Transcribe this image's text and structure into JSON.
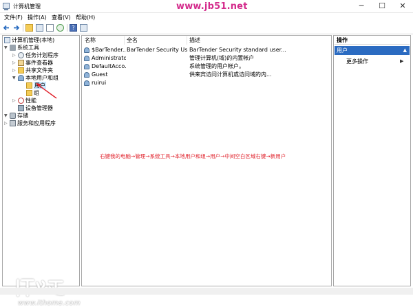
{
  "window": {
    "title": "计算机管理",
    "watermark": "www.jb51.net",
    "minimize": "─",
    "maximize": "☐",
    "close": "✕"
  },
  "menu": [
    "文件(F)",
    "操作(A)",
    "查看(V)",
    "帮助(H)"
  ],
  "tree": {
    "root": "计算机管理(本地)",
    "system_tools": "系统工具",
    "task_scheduler": "任务计划程序",
    "event_viewer": "事件查看器",
    "shared_folders": "共享文件夹",
    "local_users_groups": "本地用户和组",
    "users": "用户",
    "groups": "组",
    "performance": "性能",
    "device_manager": "设备管理器",
    "storage": "存储",
    "services_apps": "服务和应用程序"
  },
  "list": {
    "headers": {
      "name": "名称",
      "fullname": "全名",
      "desc": "描述"
    },
    "rows": [
      {
        "name": "$BarTender...",
        "fullname": "BarTender Security User",
        "desc": "BarTender Security standard user..."
      },
      {
        "name": "Administrator",
        "fullname": "",
        "desc": "管理计算机(域)的内置帐户"
      },
      {
        "name": "DefaultAcco...",
        "fullname": "",
        "desc": "系统管理的用户帐户。"
      },
      {
        "name": "Guest",
        "fullname": "",
        "desc": "供来宾访问计算机或访问域的内..."
      },
      {
        "name": "ruirui",
        "fullname": "",
        "desc": ""
      }
    ]
  },
  "annotation": "右键我的电脑→管理→系统工具→本地用户和组→用户→中间空白区域右键→新用户",
  "actions": {
    "header": "操作",
    "section": "用户",
    "more": "更多操作"
  },
  "watermark_bottom": {
    "url": "www.ithome.com",
    "logo_text": "IT之家"
  },
  "colors": {
    "accent": "#2b6bc1",
    "annotation": "#e0202a",
    "watermark": "#d42c8c",
    "selection": "#cce8ff"
  }
}
